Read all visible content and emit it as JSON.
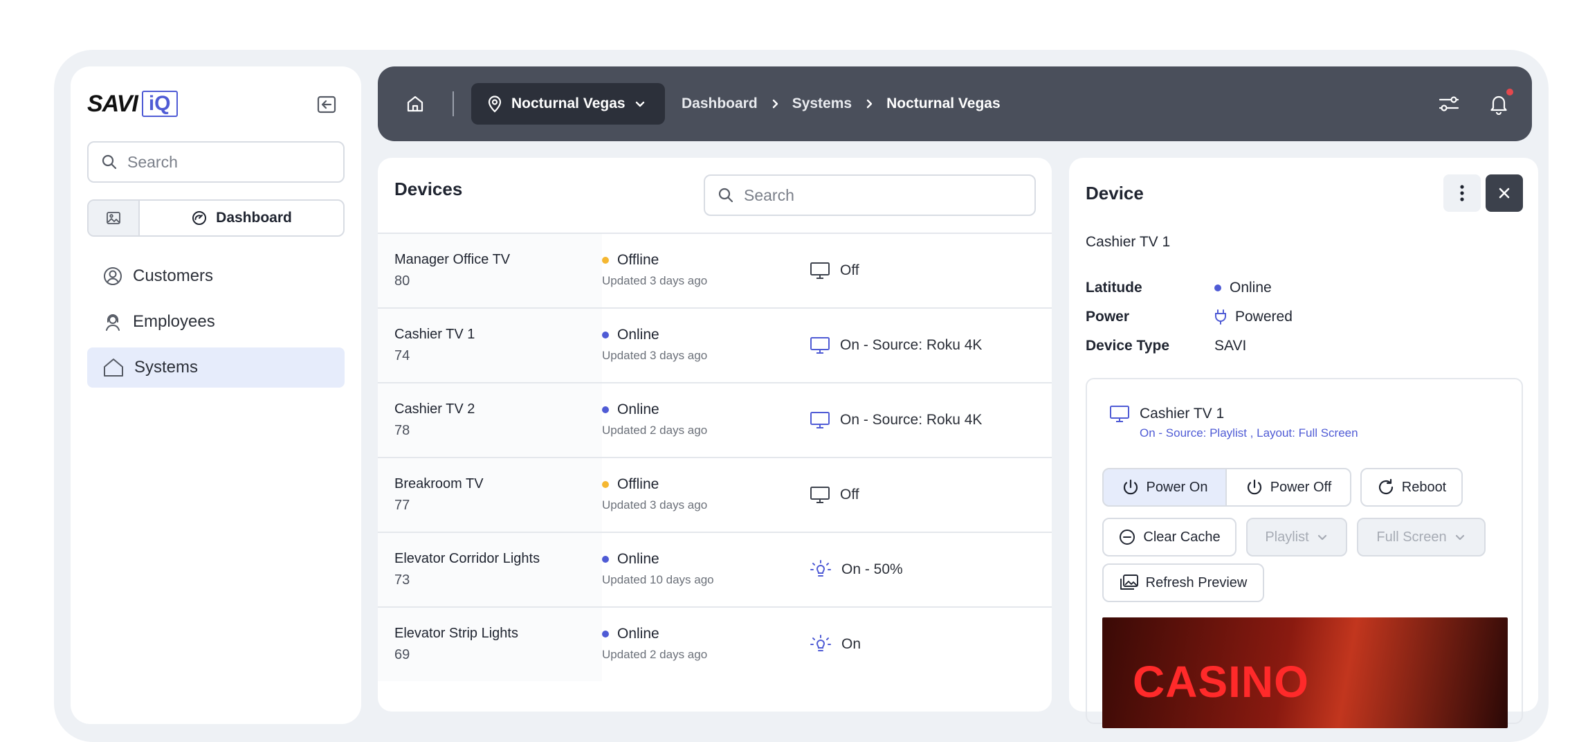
{
  "brand": {
    "logo_text": "SAVI",
    "logo_badge": "iQ"
  },
  "sidebar": {
    "search_placeholder": "Search",
    "segment_label": "Dashboard",
    "items": [
      {
        "label": "Customers",
        "icon": "user-circle-icon"
      },
      {
        "label": "Employees",
        "icon": "headset-user-icon"
      },
      {
        "label": "Systems",
        "icon": "house-icon",
        "active": true
      }
    ]
  },
  "topbar": {
    "location": "Nocturnal Vegas",
    "breadcrumbs": [
      "Dashboard",
      "Systems",
      "Nocturnal Vegas"
    ]
  },
  "devices": {
    "title": "Devices",
    "search_placeholder": "Search",
    "rows": [
      {
        "name": "Manager Office TV",
        "num": "80",
        "status": "Offline",
        "status_color": "#f5b731",
        "updated": "Updated 3 days ago",
        "icon": "monitor-icon",
        "state": "Off"
      },
      {
        "name": "Cashier TV 1",
        "num": "74",
        "status": "Online",
        "status_color": "#4f5bd5",
        "updated": "Updated 3 days ago",
        "icon": "monitor-icon",
        "state": "On - Source: Roku 4K"
      },
      {
        "name": "Cashier TV 2",
        "num": "78",
        "status": "Online",
        "status_color": "#4f5bd5",
        "updated": "Updated 2 days ago",
        "icon": "monitor-icon",
        "state": "On - Source: Roku 4K"
      },
      {
        "name": "Breakroom TV",
        "num": "77",
        "status": "Offline",
        "status_color": "#f5b731",
        "updated": "Updated 3 days ago",
        "icon": "monitor-icon",
        "state": "Off"
      },
      {
        "name": "Elevator Corridor Lights",
        "num": "73",
        "status": "Online",
        "status_color": "#4f5bd5",
        "updated": "Updated 10 days ago",
        "icon": "lightbulb-icon",
        "state": "On - 50%"
      },
      {
        "name": "Elevator Strip Lights",
        "num": "69",
        "status": "Online",
        "status_color": "#4f5bd5",
        "updated": "Updated 2 days ago",
        "icon": "lightbulb-icon",
        "state": "On"
      }
    ]
  },
  "detail": {
    "title": "Device",
    "device_name": "Cashier TV 1",
    "fields": [
      {
        "key": "Latitude",
        "value": "Online"
      },
      {
        "key": "Power",
        "value": "Powered"
      },
      {
        "key": "Device Type",
        "value": "SAVI"
      }
    ],
    "card": {
      "name": "Cashier TV 1",
      "subtitle": "On  -  Source: Playlist ,  Layout: Full Screen",
      "buttons": {
        "power_on": "Power On",
        "power_off": "Power Off",
        "reboot": "Reboot",
        "clear_cache": "Clear Cache",
        "playlist": "Playlist",
        "layout": "Full Screen",
        "refresh": "Refresh Preview"
      },
      "preview_text": "CASINO"
    }
  },
  "colors": {
    "accent": "#4f5bd5",
    "topbar": "#4a4f5b",
    "offline": "#f5b731",
    "notification": "#e5484d"
  }
}
